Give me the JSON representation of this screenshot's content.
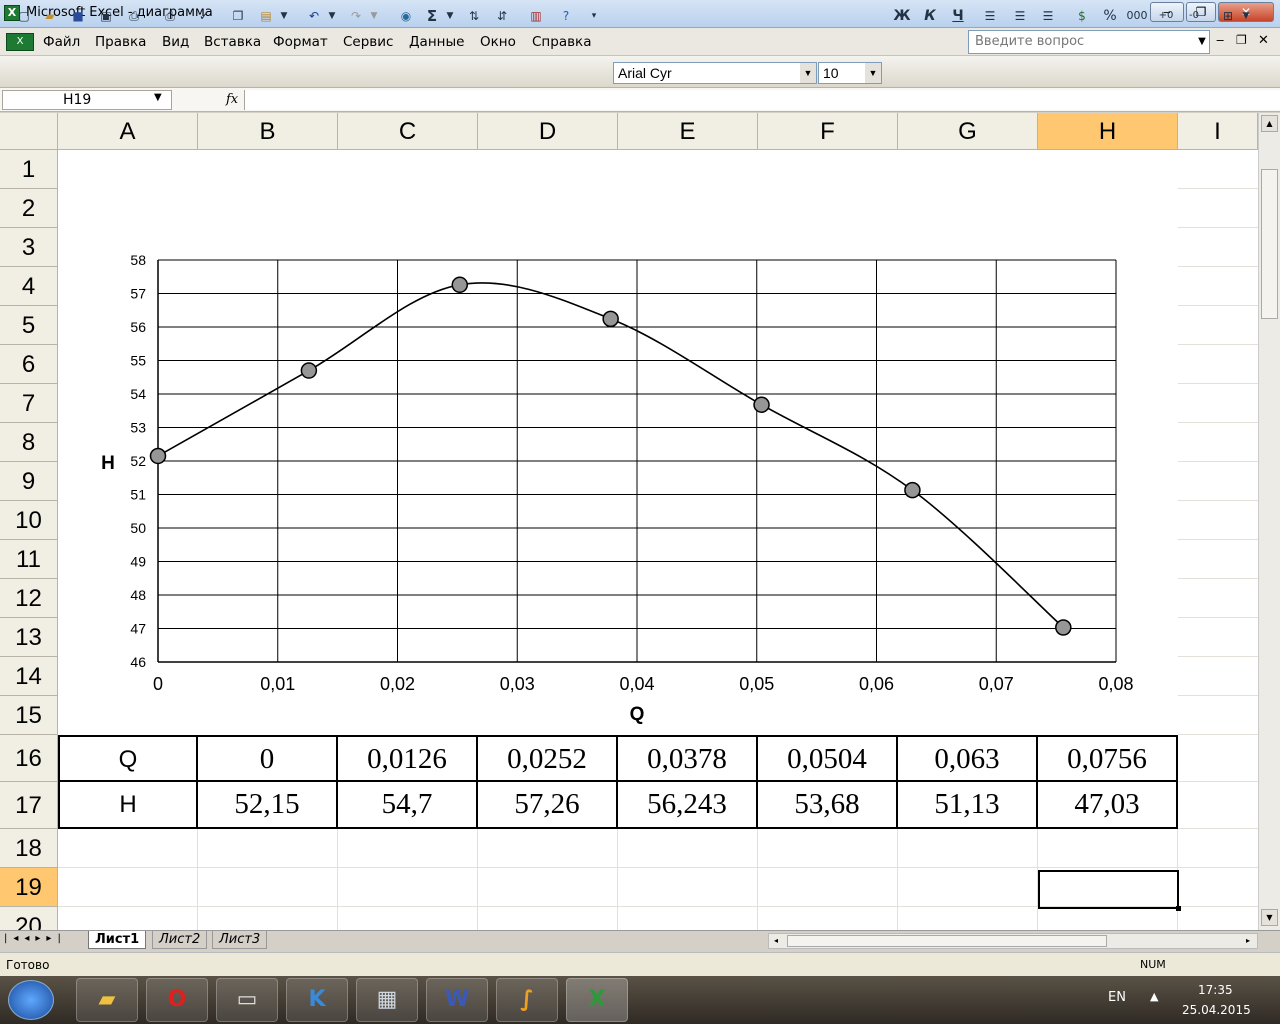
{
  "window": {
    "title": "Microsoft Excel - диаграмма",
    "min": "‒",
    "max": "❐",
    "close": "✕"
  },
  "menu": {
    "items": [
      {
        "label": "Файл"
      },
      {
        "label": "Правка"
      },
      {
        "label": "Вид"
      },
      {
        "label": "Вставка"
      },
      {
        "label": "Формат"
      },
      {
        "label": "Сервис"
      },
      {
        "label": "Данные"
      },
      {
        "label": "Окно"
      },
      {
        "label": "Справка"
      }
    ],
    "help_placeholder": "Введите вопрос"
  },
  "toolbar": {
    "font": "Arial Cyr",
    "size": "10",
    "bold": "Ж",
    "italic": "К",
    "underline": "Ч",
    "percent": "%",
    "thousands": "000",
    "sigma": "Σ"
  },
  "formula": {
    "namebox": "H19",
    "fx": "fx",
    "content": ""
  },
  "grid": {
    "columns": [
      "A",
      "B",
      "C",
      "D",
      "E",
      "F",
      "G",
      "H",
      "I"
    ],
    "rows": [
      "1",
      "2",
      "3",
      "4",
      "5",
      "6",
      "7",
      "8",
      "9",
      "10",
      "11",
      "12",
      "13",
      "14",
      "15",
      "16",
      "17",
      "18",
      "19",
      "20"
    ],
    "selected_cell": "H19"
  },
  "table": {
    "q_label": "Q",
    "h_label": "H",
    "q_values": [
      "0",
      "0,0126",
      "0,0252",
      "0,0378",
      "0,0504",
      "0,063",
      "0,0756"
    ],
    "h_values": [
      "52,15",
      "54,7",
      "57,26",
      "56,243",
      "53,68",
      "51,13",
      "47,03"
    ]
  },
  "chart_data": {
    "type": "scatter",
    "smooth": true,
    "x": [
      0,
      0.0126,
      0.0252,
      0.0378,
      0.0504,
      0.063,
      0.0756
    ],
    "y": [
      52.15,
      54.7,
      57.26,
      56.243,
      53.68,
      51.13,
      47.03
    ],
    "xlabel": "Q",
    "ylabel": "H",
    "xlim": [
      0,
      0.08
    ],
    "ylim": [
      46,
      58
    ],
    "xticks": [
      "0",
      "0,01",
      "0,02",
      "0,03",
      "0,04",
      "0,05",
      "0,06",
      "0,07",
      "0,08"
    ],
    "yticks": [
      "46",
      "47",
      "48",
      "49",
      "50",
      "51",
      "52",
      "53",
      "54",
      "55",
      "56",
      "57",
      "58"
    ],
    "grid": true,
    "line_color": "#000000",
    "marker_color": "#969696"
  },
  "sheets": {
    "tabs": [
      "Лист1",
      "Лист2",
      "Лист3"
    ],
    "active": "Лист1"
  },
  "status": {
    "text": "Готово",
    "num": "NUM"
  },
  "taskbar": {
    "lang": "EN",
    "time": "17:35",
    "date": "25.04.2015",
    "apps": [
      "folder-icon",
      "opera-icon",
      "computer-icon",
      "kompas-icon",
      "calculator-icon",
      "word-icon",
      "mathcad-icon",
      "excel-icon"
    ]
  }
}
